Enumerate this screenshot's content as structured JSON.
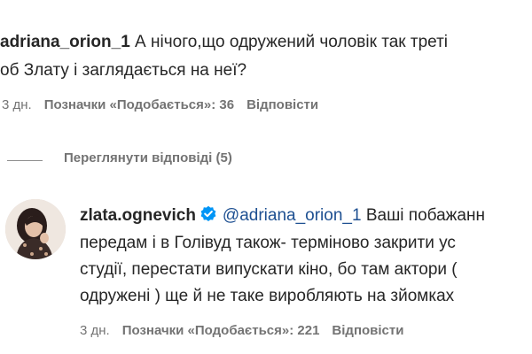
{
  "comment1": {
    "username": "adriana_orion_1",
    "line1_text": " А нічого,що одружений чоловік так треті",
    "line2_text": "об Злату і заглядається на неї?",
    "time": "3 дн.",
    "likes": "Позначки «Подобається»: 36",
    "reply": "Відповісти"
  },
  "view_replies": "Переглянути відповіді (5)",
  "comment2": {
    "username": "zlata.ognevich",
    "mention": "@adriana_orion_1",
    "line1_rest": " Ваші побажанн",
    "line2_text": "передам і в Голівуд також- терміново закрити ус",
    "line3_text": "студії, перестати випускати кіно, бо там актори (",
    "line4_text": "одружені ) ще й не таке виробляють на зйомках",
    "time": "3 дн.",
    "likes": "Позначки «Подобається»: 221",
    "reply": "Відповісти"
  },
  "colors": {
    "text": "#262626",
    "meta": "#737373",
    "verified": "#0095f6",
    "mention": "#1d4f91"
  }
}
